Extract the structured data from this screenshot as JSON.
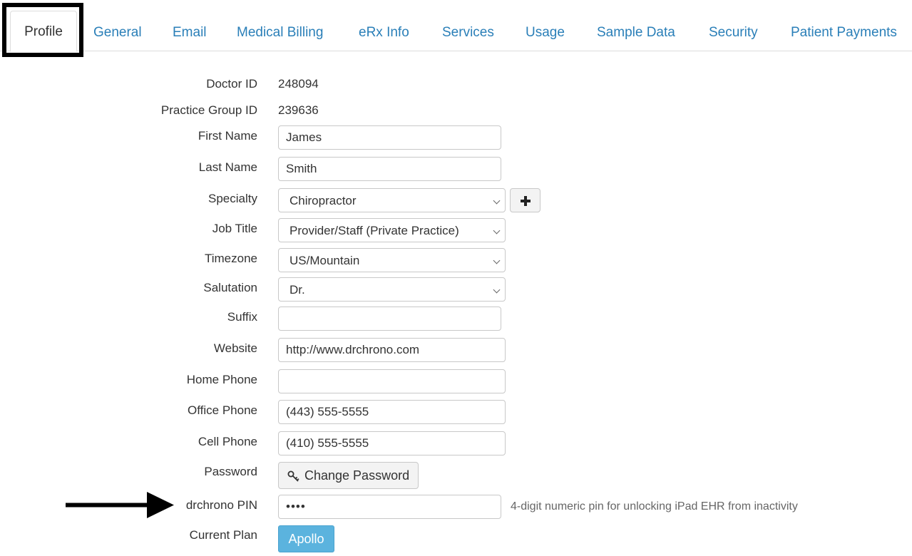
{
  "tabs": [
    {
      "label": "Profile"
    },
    {
      "label": "General"
    },
    {
      "label": "Email"
    },
    {
      "label": "Medical Billing"
    },
    {
      "label": "eRx Info"
    },
    {
      "label": "Services"
    },
    {
      "label": "Usage"
    },
    {
      "label": "Sample Data"
    },
    {
      "label": "Security"
    },
    {
      "label": "Patient Payments"
    }
  ],
  "form": {
    "doctor_id": {
      "label": "Doctor ID",
      "value": "248094"
    },
    "practice_group_id": {
      "label": "Practice Group ID",
      "value": "239636"
    },
    "first_name": {
      "label": "First Name",
      "value": "James"
    },
    "last_name": {
      "label": "Last Name",
      "value": "Smith"
    },
    "specialty": {
      "label": "Specialty",
      "value": "Chiropractor",
      "add_icon": "plus-icon"
    },
    "job_title": {
      "label": "Job Title",
      "value": "Provider/Staff (Private Practice)"
    },
    "timezone": {
      "label": "Timezone",
      "value": "US/Mountain"
    },
    "salutation": {
      "label": "Salutation",
      "value": "Dr."
    },
    "suffix": {
      "label": "Suffix",
      "value": ""
    },
    "website": {
      "label": "Website",
      "value": "http://www.drchrono.com"
    },
    "home_phone": {
      "label": "Home Phone",
      "value": ""
    },
    "office_phone": {
      "label": "Office Phone",
      "value": "(443) 555-5555"
    },
    "cell_phone": {
      "label": "Cell Phone",
      "value": "(410) 555-5555"
    },
    "password": {
      "label": "Password",
      "button_label": "Change Password",
      "icon": "key-icon"
    },
    "pin": {
      "label": "drchrono PIN",
      "value": "••••",
      "help": "4-digit numeric pin for unlocking iPad EHR from inactivity"
    },
    "current_plan": {
      "label": "Current Plan",
      "value": "Apollo"
    }
  },
  "colors": {
    "link": "#2a7fb8",
    "plan_badge": "#5bb3de",
    "highlight": "#000000"
  }
}
